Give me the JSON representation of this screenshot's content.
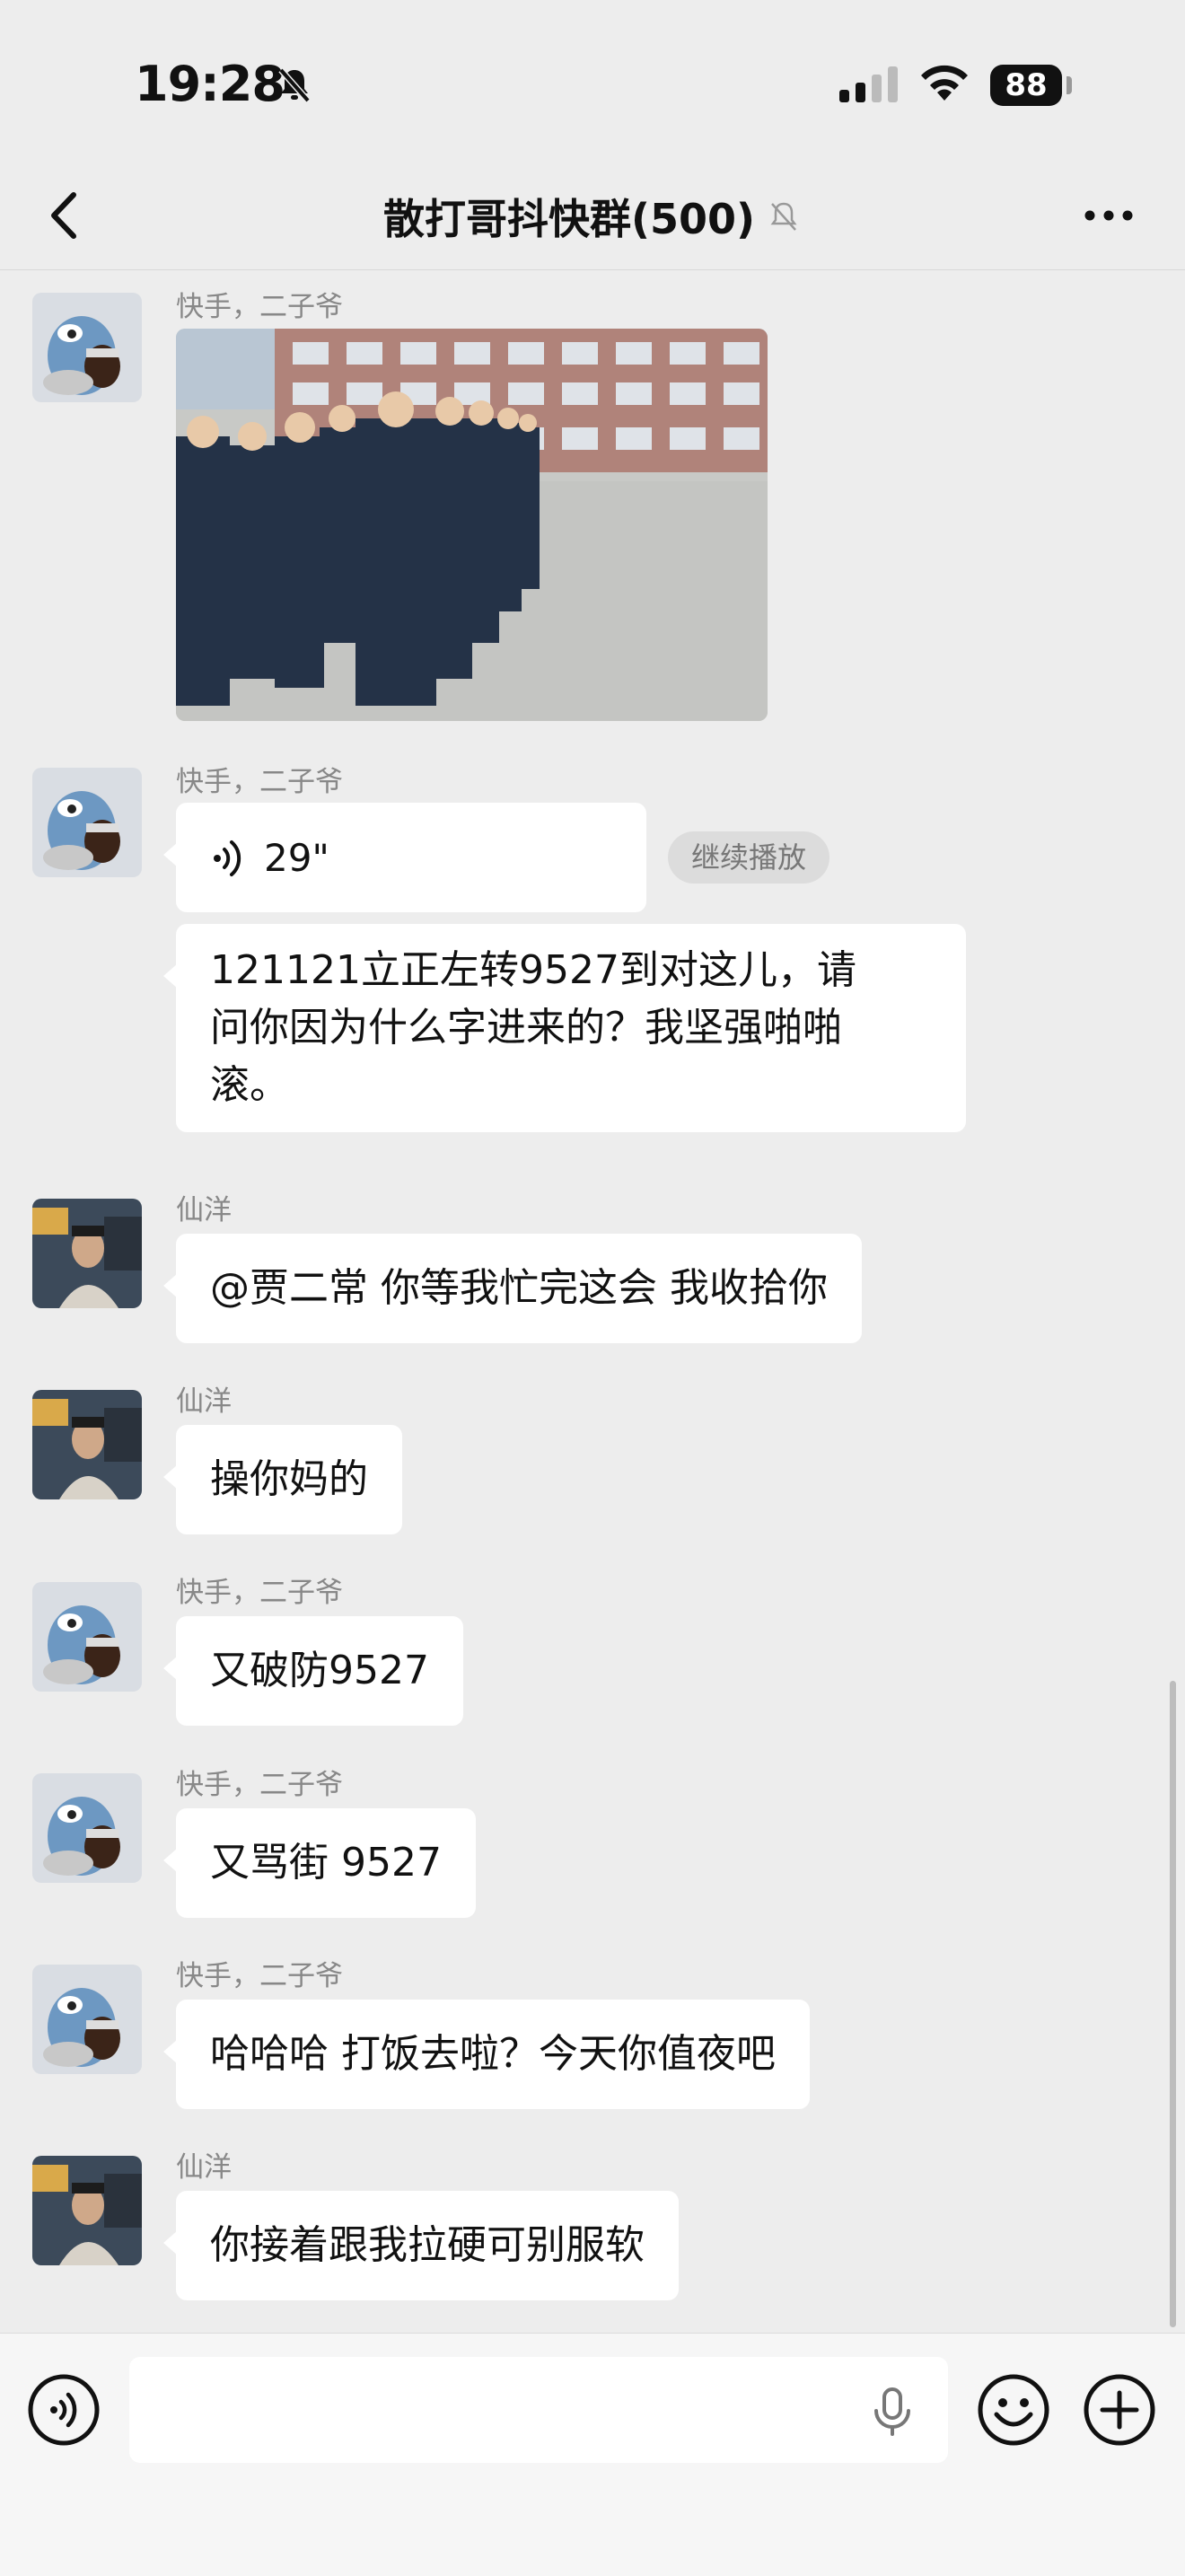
{
  "status": {
    "time": "19:28",
    "battery": "88"
  },
  "header": {
    "title": "散打哥抖快群(500)"
  },
  "messages": [
    {
      "sender": "快手，二子爷",
      "type": "image"
    },
    {
      "sender": "快手，二子爷",
      "type": "voice",
      "duration": "29\"",
      "action": "继续播放"
    },
    {
      "type": "text",
      "text": "121121立正左转9527到对这儿，请\n问你因为什么字进来的？我坚强啪啪\n滚。"
    },
    {
      "sender": "仙洋",
      "type": "text",
      "text": "@贾二常 你等我忙完这会 我收拾你"
    },
    {
      "sender": "仙洋",
      "type": "text",
      "text": "操你妈的"
    },
    {
      "sender": "快手，二子爷",
      "type": "text",
      "text": "又破防9527"
    },
    {
      "sender": "快手，二子爷",
      "type": "text",
      "text": "又骂街 9527"
    },
    {
      "sender": "快手，二子爷",
      "type": "text",
      "text": "哈哈哈 打饭去啦？今天你值夜吧"
    },
    {
      "sender": "仙洋",
      "type": "text",
      "text": "你接着跟我拉硬可别服软"
    }
  ],
  "icons": {
    "back": "chevron-left-icon",
    "mute": "bell-off-icon",
    "more": "more-dots-icon",
    "voice": "voice-icon",
    "mic": "microphone-icon",
    "emoji": "emoji-icon",
    "plus": "plus-circle-icon"
  }
}
